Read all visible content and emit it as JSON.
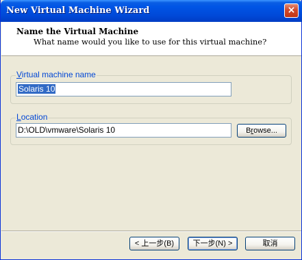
{
  "window": {
    "title": "New Virtual Machine Wizard",
    "close_glyph": "×"
  },
  "header": {
    "title": "Name the Virtual Machine",
    "subtitle": "What name would you like to use for this virtual machine?"
  },
  "name_group": {
    "label_accel": "V",
    "label_rest": "irtual machine name",
    "value": "Solaris 10"
  },
  "location_group": {
    "label_accel": "L",
    "label_rest": "ocation",
    "value": "D:\\OLD\\vmware\\Solaris 10",
    "browse_accel": "r",
    "browse_pre": "B",
    "browse_post": "owse..."
  },
  "footer": {
    "back_label": "< 上一步(B)",
    "next_label": "下一步(N) >",
    "cancel_label": "取消"
  },
  "colors": {
    "titlebar": "#0055e5",
    "group_label": "#0046d5",
    "selection": "#316ac5"
  }
}
